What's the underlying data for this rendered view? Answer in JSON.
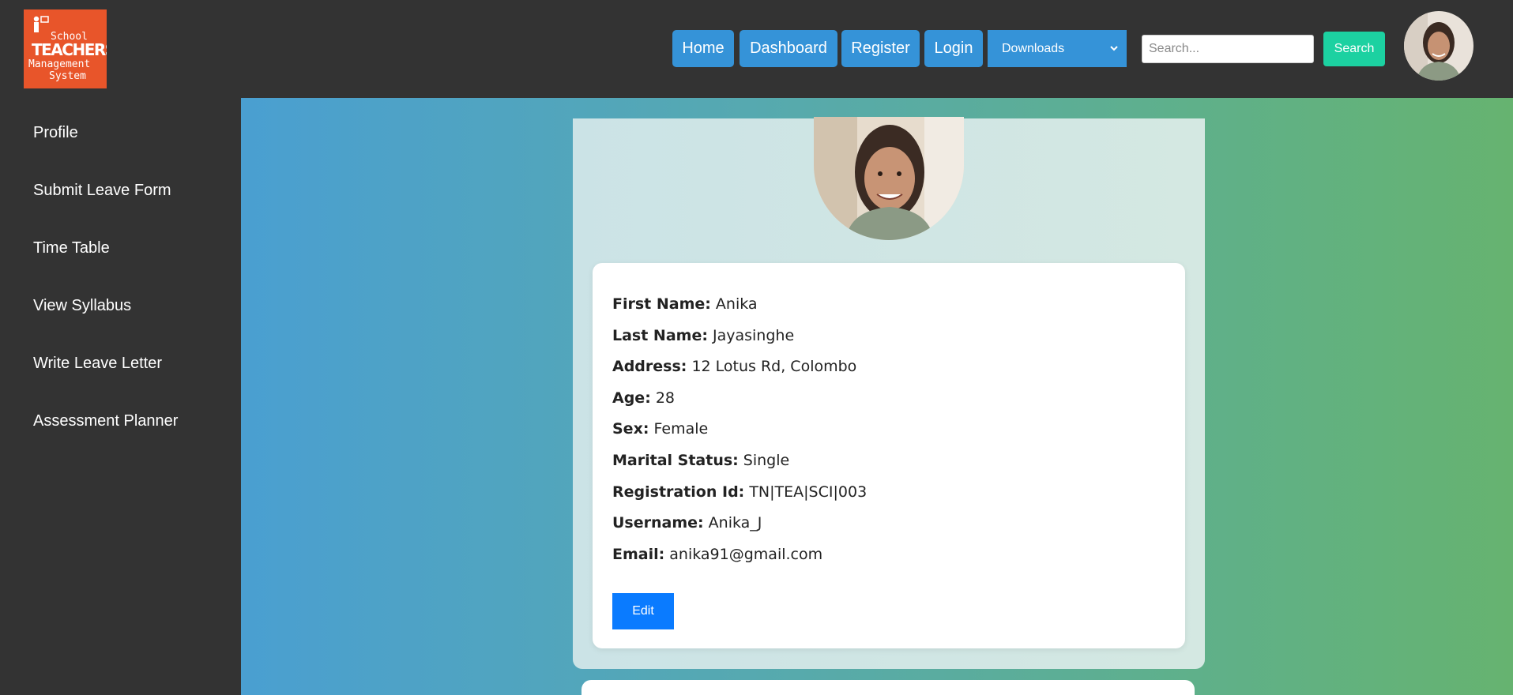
{
  "header": {
    "logo": {
      "line1": "School",
      "line2": "TEACHERS",
      "line3": "Management",
      "line4": "System"
    },
    "nav": [
      {
        "label": "Home"
      },
      {
        "label": "Dashboard"
      },
      {
        "label": "Register"
      },
      {
        "label": "Login"
      }
    ],
    "downloads_select": {
      "value": "Downloads"
    },
    "search": {
      "placeholder": "Search...",
      "button_label": "Search"
    }
  },
  "sidebar": {
    "items": [
      {
        "label": "Profile"
      },
      {
        "label": "Submit Leave Form"
      },
      {
        "label": "Time Table"
      },
      {
        "label": "View Syllabus"
      },
      {
        "label": "Write Leave Letter"
      },
      {
        "label": "Assessment Planner"
      }
    ]
  },
  "profile": {
    "fields": [
      {
        "label": "First Name:",
        "value": "Anika"
      },
      {
        "label": "Last Name:",
        "value": "Jayasinghe"
      },
      {
        "label": "Address:",
        "value": "12 Lotus Rd, Colombo"
      },
      {
        "label": "Age:",
        "value": "28"
      },
      {
        "label": "Sex:",
        "value": "Female"
      },
      {
        "label": "Marital Status:",
        "value": "Single"
      },
      {
        "label": "Registration Id:",
        "value": "TN|TEA|SCI|003"
      },
      {
        "label": "Username:",
        "value": "Anika_J"
      },
      {
        "label": "Email:",
        "value": "anika91@gmail.com"
      }
    ],
    "edit_label": "Edit"
  },
  "colors": {
    "topbar": "#333333",
    "nav_button": "#3593d8",
    "search_button": "#1cd1a1",
    "edit_button": "#0a7bff",
    "logo_bg": "#e8552a"
  }
}
